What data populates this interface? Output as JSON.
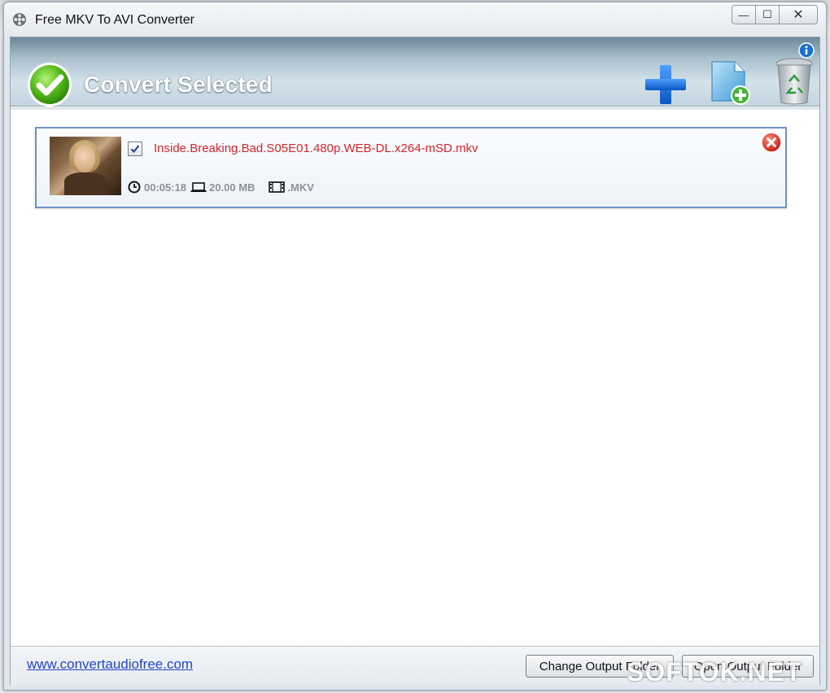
{
  "window": {
    "title": "Free MKV To AVI Converter",
    "minimize_glyph": "—",
    "maximize_glyph": "☐",
    "close_glyph": "✕"
  },
  "toolbar": {
    "convert_label": "Convert Selected",
    "icons": [
      "check-circle-icon",
      "info-icon",
      "plus-icon",
      "add-file-icon",
      "trash-icon"
    ]
  },
  "files": [
    {
      "checked": true,
      "name": "Inside.Breaking.Bad.S05E01.480p.WEB-DL.x264-mSD.mkv",
      "duration": "00:05:18",
      "size": "20.00 MB",
      "format": ".MKV"
    }
  ],
  "footer": {
    "link": "www.convertaudiofree.com",
    "change_button": "Change Output Folder",
    "open_button": "Open Output Folder"
  },
  "watermark": "SOFTOK.NET",
  "colors": {
    "accent_red": "#d8232a",
    "link_blue": "#2244cc",
    "selection_border": "#6d93c5"
  }
}
